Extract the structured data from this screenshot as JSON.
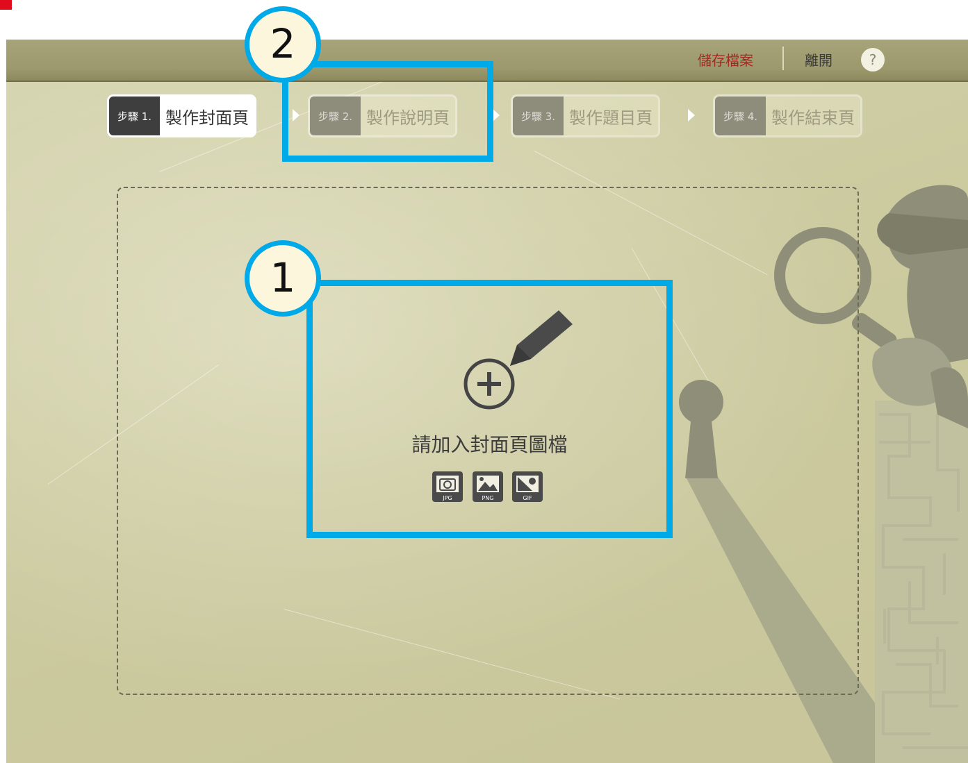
{
  "topbar": {
    "save_label": "儲存檔案",
    "exit_label": "離開",
    "help_label": "?"
  },
  "steps": [
    {
      "num": "步驟 1.",
      "label": "製作封面頁",
      "state": "active"
    },
    {
      "num": "步驟 2.",
      "label": "製作說明頁",
      "state": "inactive"
    },
    {
      "num": "步驟 3.",
      "label": "製作題目頁",
      "state": "inactive"
    },
    {
      "num": "步驟 4.",
      "label": "製作結束頁",
      "state": "inactive"
    }
  ],
  "upload": {
    "prompt": "請加入封面頁圖檔",
    "formats": [
      "JPG",
      "PNG",
      "GIF"
    ]
  },
  "annotations": [
    "1",
    "2"
  ],
  "colors": {
    "annotation": "#00a9e8",
    "save_link": "#a12a22",
    "active_step": "#3e3e3e",
    "background": "#cfcda4"
  },
  "icons": [
    "plus-circle-icon",
    "pencil-icon",
    "jpg-file-icon",
    "png-file-icon",
    "gif-file-icon",
    "help-icon",
    "step-arrow-icon",
    "detective-illustration",
    "keyhole-illustration",
    "maze-illustration"
  ]
}
